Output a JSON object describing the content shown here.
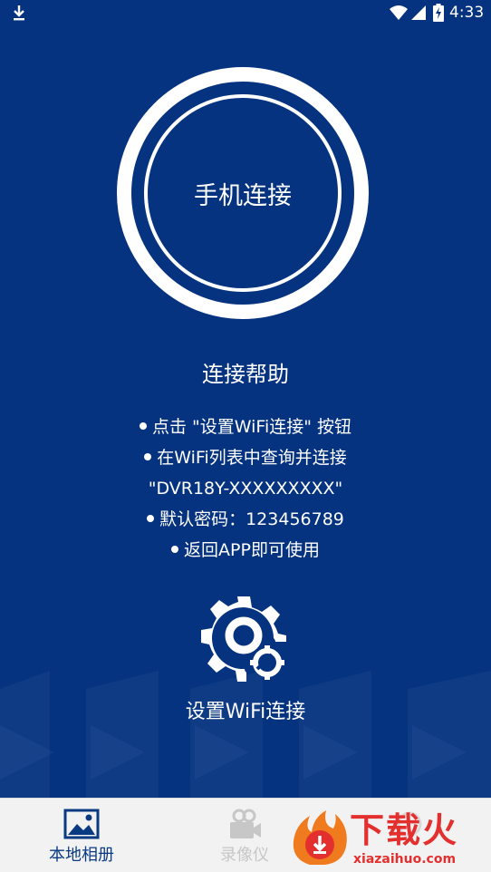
{
  "status_bar": {
    "time": "4:33"
  },
  "main": {
    "connect_button_label": "手机连接",
    "help_title": "连接帮助",
    "help_steps": [
      "点击 \"设置WiFi连接\" 按钮",
      "在WiFi列表中查询并连接",
      "\"DVR18Y-XXXXXXXXX\"",
      "默认密码：123456789",
      "返回APP即可使用"
    ],
    "wifi_settings_label": "设置WiFi连接"
  },
  "bottom_nav": {
    "items": [
      {
        "label": "本地相册",
        "icon": "image-icon",
        "active": true
      },
      {
        "label": "录像仪",
        "icon": "camera-icon",
        "active": false
      },
      {
        "label": "",
        "icon": "settings-icon",
        "active": false
      }
    ]
  },
  "watermark": {
    "title": "下载火",
    "url": "xiazaihuo.com"
  },
  "colors": {
    "background": "#053380",
    "nav_background": "#f2f2f2",
    "active_nav": "#0a3a82",
    "watermark_red": "#e3302f"
  }
}
